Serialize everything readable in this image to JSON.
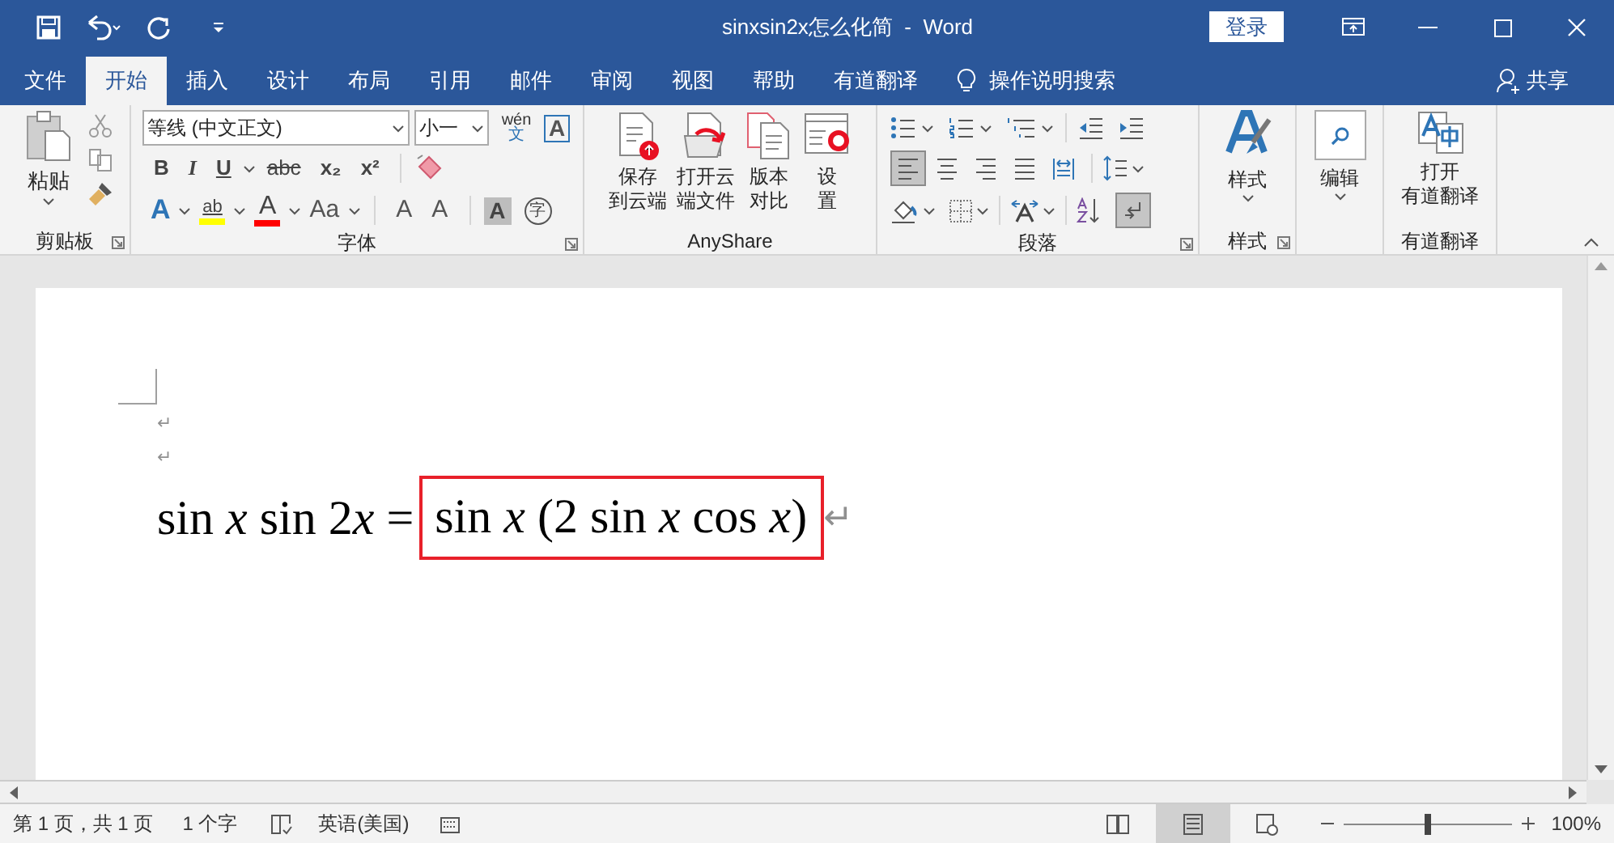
{
  "window": {
    "title": "sinxsin2x怎么化简  -  Word",
    "login_button": "登录"
  },
  "tabs": [
    {
      "label": "文件",
      "selected": false
    },
    {
      "label": "开始",
      "selected": true
    },
    {
      "label": "插入",
      "selected": false
    },
    {
      "label": "设计",
      "selected": false
    },
    {
      "label": "布局",
      "selected": false
    },
    {
      "label": "引用",
      "selected": false
    },
    {
      "label": "邮件",
      "selected": false
    },
    {
      "label": "审阅",
      "selected": false
    },
    {
      "label": "视图",
      "selected": false
    },
    {
      "label": "帮助",
      "selected": false
    },
    {
      "label": "有道翻译",
      "selected": false
    }
  ],
  "tell_me": "操作说明搜索",
  "share": "共享",
  "ribbon": {
    "clipboard": {
      "label": "剪贴板",
      "paste": "粘贴"
    },
    "font": {
      "label": "字体",
      "font_name": "等线 (中文正文)",
      "font_size": "小一",
      "phonetic": "wén",
      "phonetic_char": "文",
      "border_char": "A",
      "row2": [
        {
          "label": "B",
          "kind": "bold"
        },
        {
          "label": "I",
          "kind": "italic"
        },
        {
          "label": "U",
          "kind": "underline"
        },
        {
          "label": "abc",
          "kind": "strike"
        },
        {
          "label": "x₂",
          "kind": "subscript"
        },
        {
          "label": "x²",
          "kind": "superscript"
        }
      ],
      "row3": [
        {
          "label": "A",
          "kind": "effect"
        },
        {
          "label": "ab",
          "kind": "highlight",
          "color": "#ffff00"
        },
        {
          "label": "A",
          "kind": "color",
          "color": "#ff0000"
        },
        {
          "label": "Aa",
          "kind": "case"
        },
        {
          "label": "A",
          "kind": "grow"
        },
        {
          "label": "A",
          "kind": "shrink"
        },
        {
          "label": "A",
          "kind": "shade"
        },
        {
          "label": "字",
          "kind": "enclose"
        }
      ]
    },
    "anyshare": {
      "label": "AnyShare",
      "buttons": [
        {
          "lines": [
            "保存",
            "到云端"
          ],
          "kind": "cloud-save"
        },
        {
          "lines": [
            "打开云",
            "端文件"
          ],
          "kind": "cloud-open"
        },
        {
          "lines": [
            "版本",
            "对比"
          ],
          "kind": "compare"
        },
        {
          "lines": [
            "设",
            "置"
          ],
          "kind": "settings"
        }
      ]
    },
    "paragraph": {
      "label": "段落",
      "alignments": [
        {
          "selected": true
        },
        {
          "selected": false
        },
        {
          "selected": false
        },
        {
          "selected": false
        },
        {
          "selected": false
        }
      ],
      "show_marks": true
    },
    "styles": {
      "label": "样式",
      "button": "样式"
    },
    "editing": {
      "button": "编辑"
    },
    "youdao": {
      "label": "有道翻译",
      "lines": [
        "打开",
        "有道翻译"
      ]
    }
  },
  "document": {
    "empty_marks": [
      "↵",
      "↵"
    ],
    "equation_left": [
      {
        "text": "sin ",
        "kind": "function"
      },
      {
        "text": "x",
        "kind": "variable"
      },
      {
        "text": " sin 2",
        "kind": "function"
      },
      {
        "text": "x",
        "kind": "variable"
      },
      {
        "text": " =",
        "kind": "function"
      }
    ],
    "equation_boxed": [
      {
        "text": "sin ",
        "kind": "function"
      },
      {
        "text": "x",
        "kind": "variable"
      },
      {
        "text": " (2 sin ",
        "kind": "function"
      },
      {
        "text": "x",
        "kind": "variable"
      },
      {
        "text": " cos ",
        "kind": "function"
      },
      {
        "text": "x",
        "kind": "variable"
      },
      {
        "text": ")",
        "kind": "function"
      }
    ],
    "end_mark": "↵"
  },
  "status_bar": {
    "page": "第 1 页，共 1 页",
    "words": "1 个字",
    "language": "英语(美国)",
    "views": [
      {
        "kind": "read",
        "selected": false
      },
      {
        "kind": "print",
        "selected": true
      },
      {
        "kind": "web",
        "selected": false
      }
    ],
    "zoom": {
      "level": 0.5,
      "reading": "100%"
    }
  }
}
